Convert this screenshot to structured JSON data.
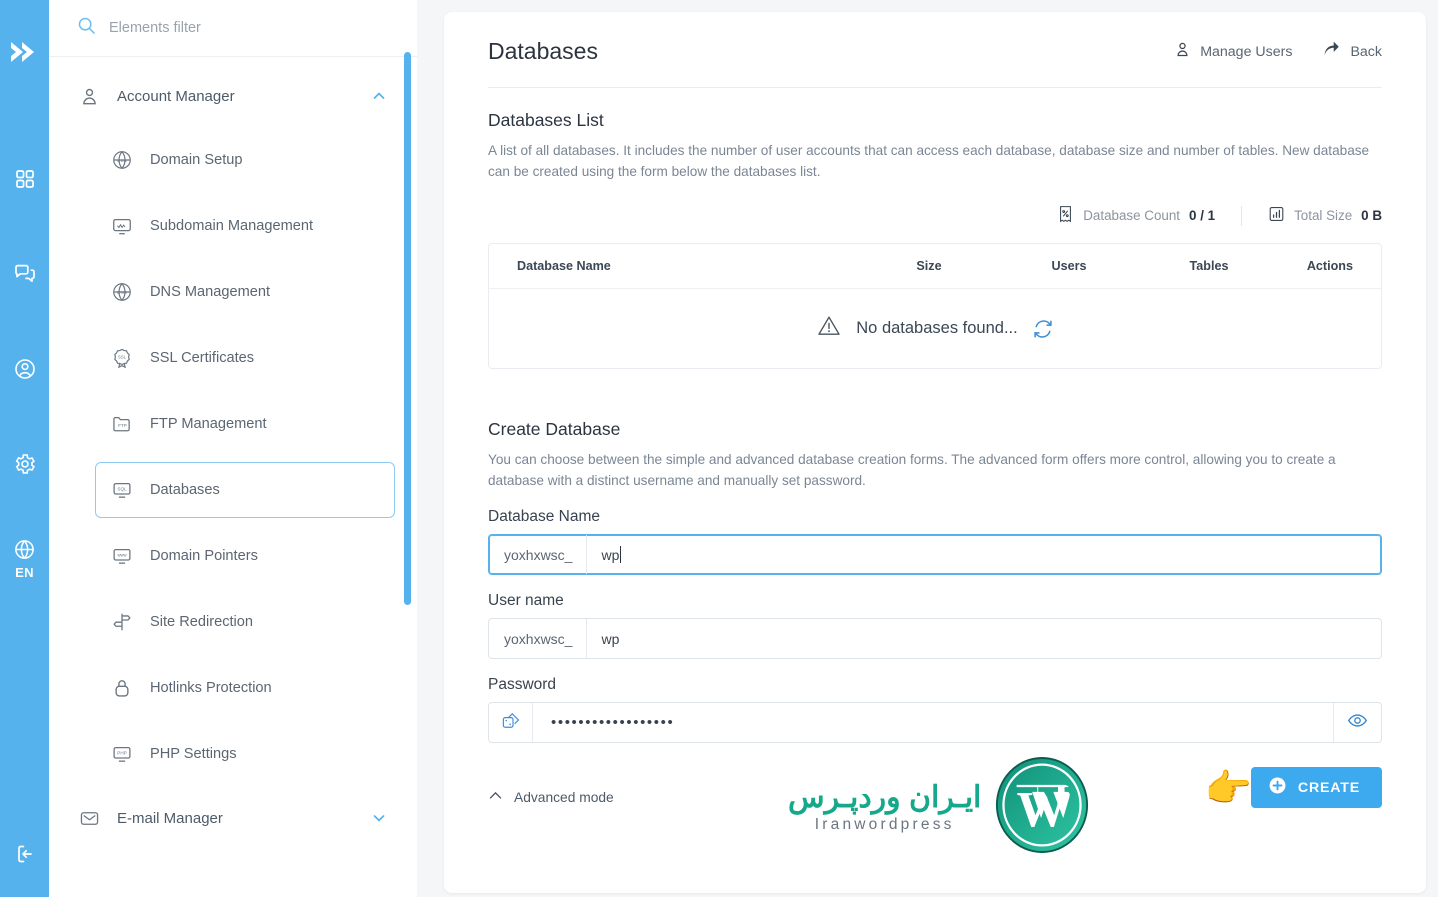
{
  "rail": {
    "logo_name": "chevrons-right-logo",
    "items": [
      {
        "icon": "grid-icon",
        "name": "dashboard"
      },
      {
        "icon": "chat-icon",
        "name": "support-chat"
      },
      {
        "icon": "user-circle-icon",
        "name": "account"
      },
      {
        "icon": "gear-icon",
        "name": "settings"
      },
      {
        "icon": "globe-icon",
        "name": "language",
        "label": "EN"
      }
    ],
    "logout_icon": "logout-icon"
  },
  "sidebar": {
    "filter": {
      "placeholder": "Elements filter",
      "value": "",
      "icon": "search-icon"
    },
    "group": {
      "label": "Account Manager",
      "icon": "user-icon",
      "chevron": "chevron-up-icon"
    },
    "items": [
      {
        "label": "Domain Setup",
        "icon": "globe-www-icon",
        "active": false
      },
      {
        "label": "Subdomain Management",
        "icon": "monitor-icon",
        "active": false
      },
      {
        "label": "DNS Management",
        "icon": "globe-dns-icon",
        "active": false
      },
      {
        "label": "SSL Certificates",
        "icon": "ssl-badge-icon",
        "active": false
      },
      {
        "label": "FTP Management",
        "icon": "folder-ftp-icon",
        "active": false
      },
      {
        "label": "Databases",
        "icon": "sql-monitor-icon",
        "active": true
      },
      {
        "label": "Domain Pointers",
        "icon": "monitor-www-icon",
        "active": false
      },
      {
        "label": "Site Redirection",
        "icon": "signpost-icon",
        "active": false
      },
      {
        "label": "Hotlinks Protection",
        "icon": "lock-icon",
        "active": false
      },
      {
        "label": "PHP Settings",
        "icon": "monitor-php-icon",
        "active": false
      }
    ],
    "group2": {
      "label": "E-mail Manager",
      "icon": "envelope-icon",
      "chevron": "chevron-down-icon"
    }
  },
  "header": {
    "title": "Databases",
    "manage_users": "Manage Users",
    "back": "Back"
  },
  "list": {
    "title": "Databases List",
    "description": "A list of all databases. It includes the number of user accounts that can access each database, database size and number of tables. New database can be created using the form below the databases list.",
    "stats": [
      {
        "icon": "receipt-percent-icon",
        "label": "Database Count",
        "value": "0 / 1"
      },
      {
        "icon": "bar-chart-icon",
        "label": "Total Size",
        "value": "0 B"
      }
    ],
    "columns": [
      "Database Name",
      "Size",
      "Users",
      "Tables",
      "Actions"
    ],
    "empty_text": "No databases found...",
    "empty_icon": "warning-triangle-icon",
    "reload_icon": "refresh-icon"
  },
  "create": {
    "title": "Create Database",
    "description": "You can choose between the simple and advanced database creation forms. The advanced form offers more control, allowing you to create a database with a distinct username and manually set password.",
    "db_name": {
      "label": "Database Name",
      "prefix": "yoxhxwsc_",
      "value": "wp"
    },
    "user_name": {
      "label": "User name",
      "prefix": "yoxhxwsc_",
      "value": "wp"
    },
    "password": {
      "label": "Password",
      "value": "••••••••••••••••••",
      "generate_icon": "dice-icon",
      "reveal_icon": "eye-icon"
    },
    "advanced_mode": {
      "label": "Advanced mode",
      "icon": "chevron-up-icon"
    },
    "create_button": {
      "label": "CREATE",
      "icon": "plus-circle-icon"
    },
    "cursor_icon": "pointing-hand-cursor"
  },
  "watermark": {
    "fa": "ایـران وردپـرس",
    "en": "Iranwordpress",
    "logo": "wordpress-logo"
  },
  "colors": {
    "accent": "#56b2ec",
    "button": "#3daaf0",
    "watermark_green": "#16a88a"
  }
}
